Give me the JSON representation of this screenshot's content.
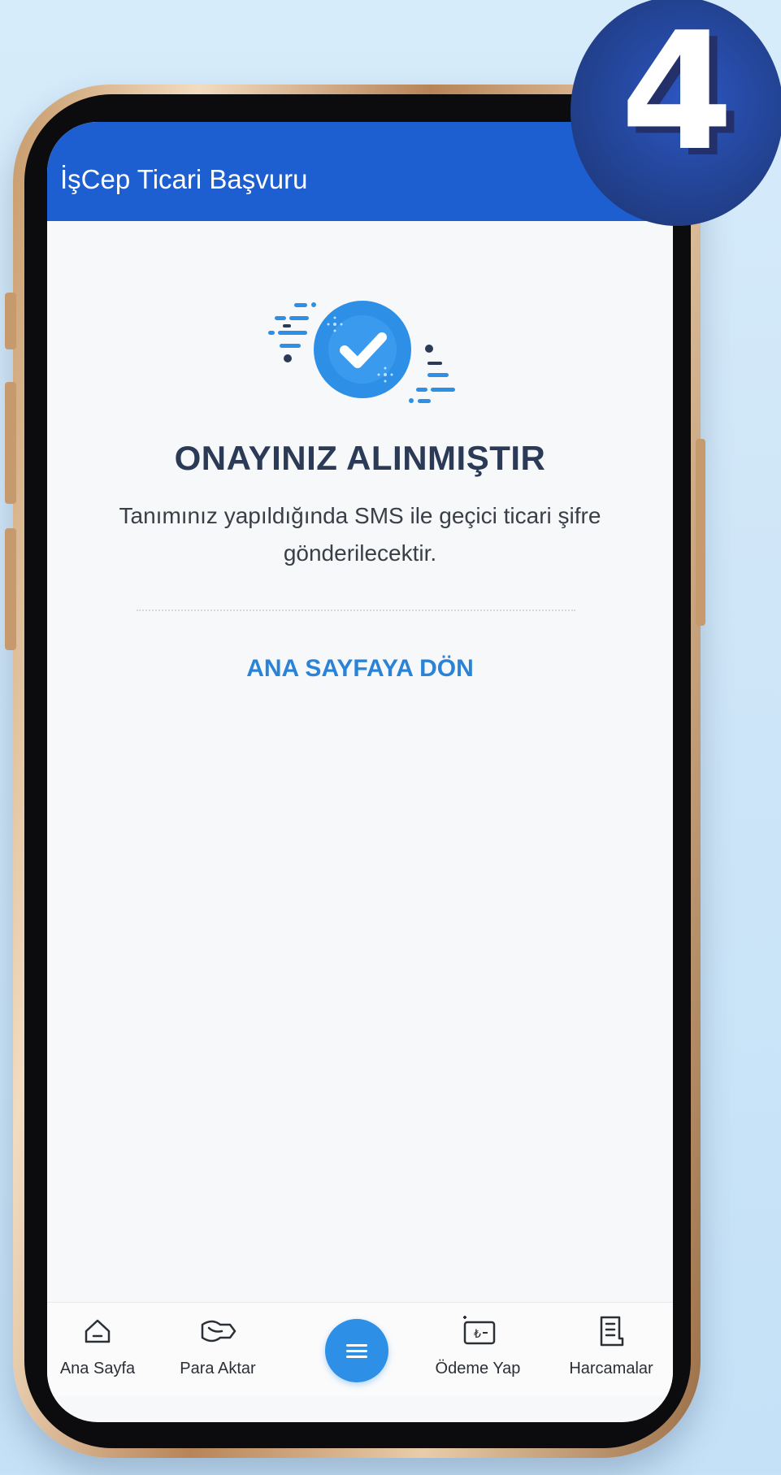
{
  "app_bar": {
    "title": "İşCep Ticari Başvuru"
  },
  "success": {
    "icon": "check-circle-icon",
    "headline": "ONAYINIZ ALINMIŞTIR",
    "message": "Tanımınız yapıldığında SMS ile geçici ticari şifre gönderilecektir.",
    "home_link": "ANA SAYFAYA DÖN"
  },
  "tab_bar": {
    "items": [
      {
        "label": "Ana Sayfa",
        "icon": "home-icon"
      },
      {
        "label": "Para Aktar",
        "icon": "money-transfer-icon"
      },
      {
        "label": "",
        "icon": "menu-icon"
      },
      {
        "label": "Ödeme Yap",
        "icon": "payment-icon"
      },
      {
        "label": "Harcamalar",
        "icon": "receipt-icon"
      }
    ]
  },
  "step_badge": {
    "number": "4"
  },
  "colors": {
    "app_bar": "#1d5fd0",
    "accent": "#2d8fe6",
    "link": "#2a83d6",
    "headline": "#2a3a57",
    "badge": "#22418f"
  }
}
